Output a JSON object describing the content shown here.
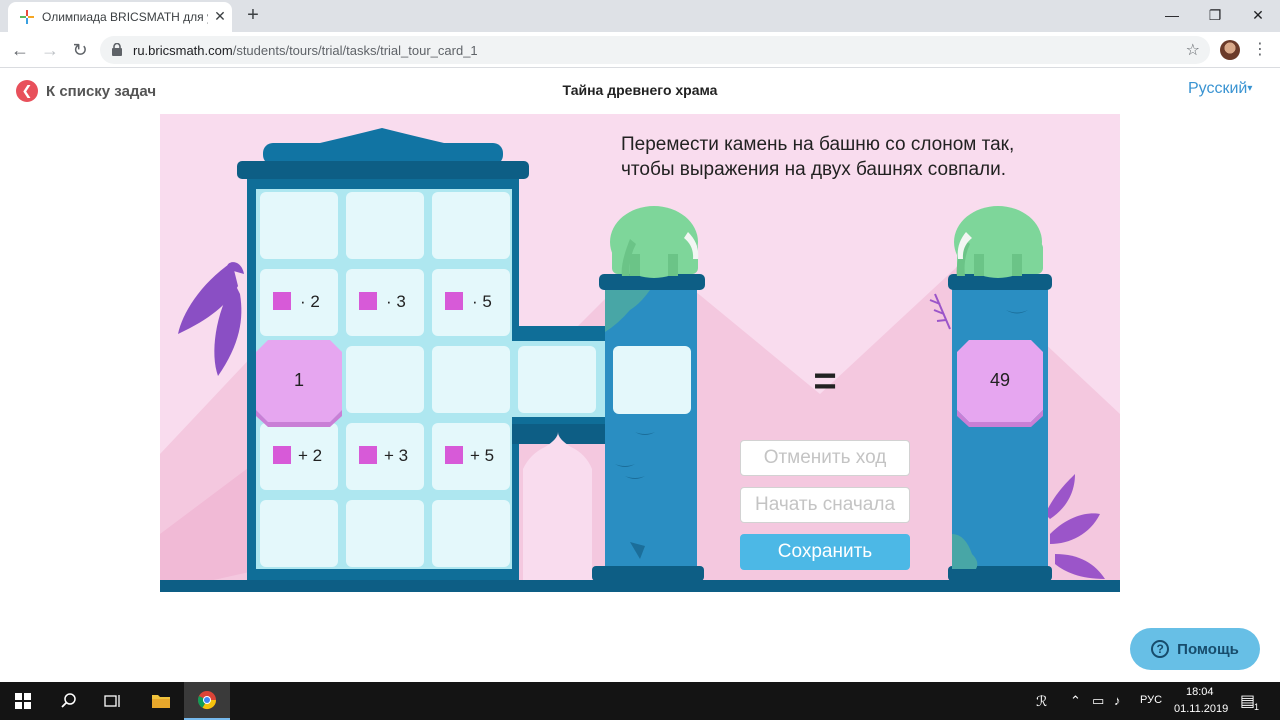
{
  "browser": {
    "tab_title": "Олимпиада BRICSMATH для уче",
    "tab_close": "✕",
    "new_tab": "+",
    "url_host": "ru.bricsmath.com",
    "url_path": "/students/tours/trial/tasks/trial_tour_card_1",
    "window_controls": {
      "minimize": "—",
      "maximize": "❐",
      "close": "✕"
    }
  },
  "header": {
    "back_label": "К списку задач",
    "title": "Тайна древнего храма",
    "language": "Русский"
  },
  "game": {
    "instruction_line1": "Перемести камень на башню со слоном так,",
    "instruction_line2": "чтобы выражения на двух башнях совпали.",
    "ops_multiply": [
      "· 2",
      "· 3",
      "· 5"
    ],
    "ops_add": [
      "+ 2",
      "+ 3",
      "+ 5"
    ],
    "start_stone": "1",
    "equals": "=",
    "target_value": "49"
  },
  "buttons": {
    "undo": "Отменить ход",
    "reset": "Начать сначала",
    "save": "Сохранить"
  },
  "help": {
    "label": "Помощь",
    "icon_char": "?"
  },
  "taskbar": {
    "language": "РУС",
    "time": "18:04",
    "date": "01.11.2019",
    "notification_count": "1"
  },
  "colors": {
    "tower_dark": "#0f6e98",
    "tower_mid": "#2a8ec2",
    "tile": "#e4f8fb",
    "stone": "#e6a6f0",
    "pink_square": "#d75ad8",
    "elephant": "#7ed69a",
    "save_button": "#4cb8e6",
    "back_button": "#e8505b"
  }
}
